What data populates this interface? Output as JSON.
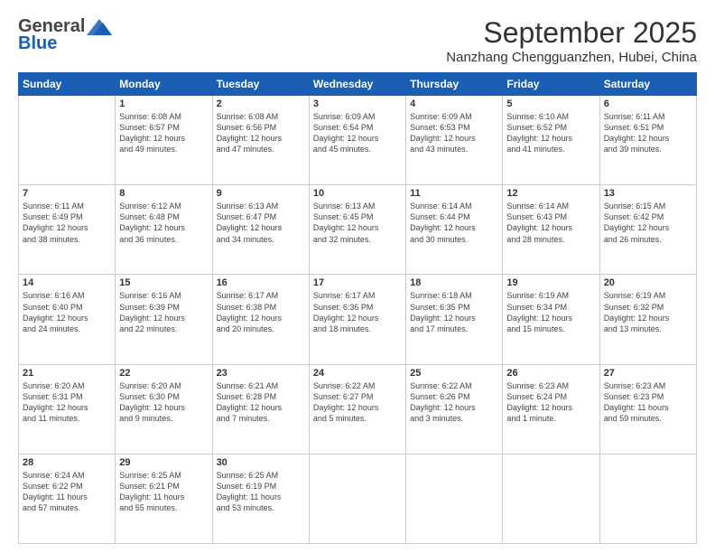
{
  "header": {
    "logo_general": "General",
    "logo_blue": "Blue",
    "month_title": "September 2025",
    "location": "Nanzhang Chengguanzhen, Hubei, China"
  },
  "days_of_week": [
    "Sunday",
    "Monday",
    "Tuesday",
    "Wednesday",
    "Thursday",
    "Friday",
    "Saturday"
  ],
  "weeks": [
    [
      {
        "day": "",
        "info": ""
      },
      {
        "day": "1",
        "info": "Sunrise: 6:08 AM\nSunset: 6:57 PM\nDaylight: 12 hours\nand 49 minutes."
      },
      {
        "day": "2",
        "info": "Sunrise: 6:08 AM\nSunset: 6:56 PM\nDaylight: 12 hours\nand 47 minutes."
      },
      {
        "day": "3",
        "info": "Sunrise: 6:09 AM\nSunset: 6:54 PM\nDaylight: 12 hours\nand 45 minutes."
      },
      {
        "day": "4",
        "info": "Sunrise: 6:09 AM\nSunset: 6:53 PM\nDaylight: 12 hours\nand 43 minutes."
      },
      {
        "day": "5",
        "info": "Sunrise: 6:10 AM\nSunset: 6:52 PM\nDaylight: 12 hours\nand 41 minutes."
      },
      {
        "day": "6",
        "info": "Sunrise: 6:11 AM\nSunset: 6:51 PM\nDaylight: 12 hours\nand 39 minutes."
      }
    ],
    [
      {
        "day": "7",
        "info": "Sunrise: 6:11 AM\nSunset: 6:49 PM\nDaylight: 12 hours\nand 38 minutes."
      },
      {
        "day": "8",
        "info": "Sunrise: 6:12 AM\nSunset: 6:48 PM\nDaylight: 12 hours\nand 36 minutes."
      },
      {
        "day": "9",
        "info": "Sunrise: 6:13 AM\nSunset: 6:47 PM\nDaylight: 12 hours\nand 34 minutes."
      },
      {
        "day": "10",
        "info": "Sunrise: 6:13 AM\nSunset: 6:45 PM\nDaylight: 12 hours\nand 32 minutes."
      },
      {
        "day": "11",
        "info": "Sunrise: 6:14 AM\nSunset: 6:44 PM\nDaylight: 12 hours\nand 30 minutes."
      },
      {
        "day": "12",
        "info": "Sunrise: 6:14 AM\nSunset: 6:43 PM\nDaylight: 12 hours\nand 28 minutes."
      },
      {
        "day": "13",
        "info": "Sunrise: 6:15 AM\nSunset: 6:42 PM\nDaylight: 12 hours\nand 26 minutes."
      }
    ],
    [
      {
        "day": "14",
        "info": "Sunrise: 6:16 AM\nSunset: 6:40 PM\nDaylight: 12 hours\nand 24 minutes."
      },
      {
        "day": "15",
        "info": "Sunrise: 6:16 AM\nSunset: 6:39 PM\nDaylight: 12 hours\nand 22 minutes."
      },
      {
        "day": "16",
        "info": "Sunrise: 6:17 AM\nSunset: 6:38 PM\nDaylight: 12 hours\nand 20 minutes."
      },
      {
        "day": "17",
        "info": "Sunrise: 6:17 AM\nSunset: 6:36 PM\nDaylight: 12 hours\nand 18 minutes."
      },
      {
        "day": "18",
        "info": "Sunrise: 6:18 AM\nSunset: 6:35 PM\nDaylight: 12 hours\nand 17 minutes."
      },
      {
        "day": "19",
        "info": "Sunrise: 6:19 AM\nSunset: 6:34 PM\nDaylight: 12 hours\nand 15 minutes."
      },
      {
        "day": "20",
        "info": "Sunrise: 6:19 AM\nSunset: 6:32 PM\nDaylight: 12 hours\nand 13 minutes."
      }
    ],
    [
      {
        "day": "21",
        "info": "Sunrise: 6:20 AM\nSunset: 6:31 PM\nDaylight: 12 hours\nand 11 minutes."
      },
      {
        "day": "22",
        "info": "Sunrise: 6:20 AM\nSunset: 6:30 PM\nDaylight: 12 hours\nand 9 minutes."
      },
      {
        "day": "23",
        "info": "Sunrise: 6:21 AM\nSunset: 6:28 PM\nDaylight: 12 hours\nand 7 minutes."
      },
      {
        "day": "24",
        "info": "Sunrise: 6:22 AM\nSunset: 6:27 PM\nDaylight: 12 hours\nand 5 minutes."
      },
      {
        "day": "25",
        "info": "Sunrise: 6:22 AM\nSunset: 6:26 PM\nDaylight: 12 hours\nand 3 minutes."
      },
      {
        "day": "26",
        "info": "Sunrise: 6:23 AM\nSunset: 6:24 PM\nDaylight: 12 hours\nand 1 minute."
      },
      {
        "day": "27",
        "info": "Sunrise: 6:23 AM\nSunset: 6:23 PM\nDaylight: 11 hours\nand 59 minutes."
      }
    ],
    [
      {
        "day": "28",
        "info": "Sunrise: 6:24 AM\nSunset: 6:22 PM\nDaylight: 11 hours\nand 57 minutes."
      },
      {
        "day": "29",
        "info": "Sunrise: 6:25 AM\nSunset: 6:21 PM\nDaylight: 11 hours\nand 55 minutes."
      },
      {
        "day": "30",
        "info": "Sunrise: 6:25 AM\nSunset: 6:19 PM\nDaylight: 11 hours\nand 53 minutes."
      },
      {
        "day": "",
        "info": ""
      },
      {
        "day": "",
        "info": ""
      },
      {
        "day": "",
        "info": ""
      },
      {
        "day": "",
        "info": ""
      }
    ]
  ]
}
